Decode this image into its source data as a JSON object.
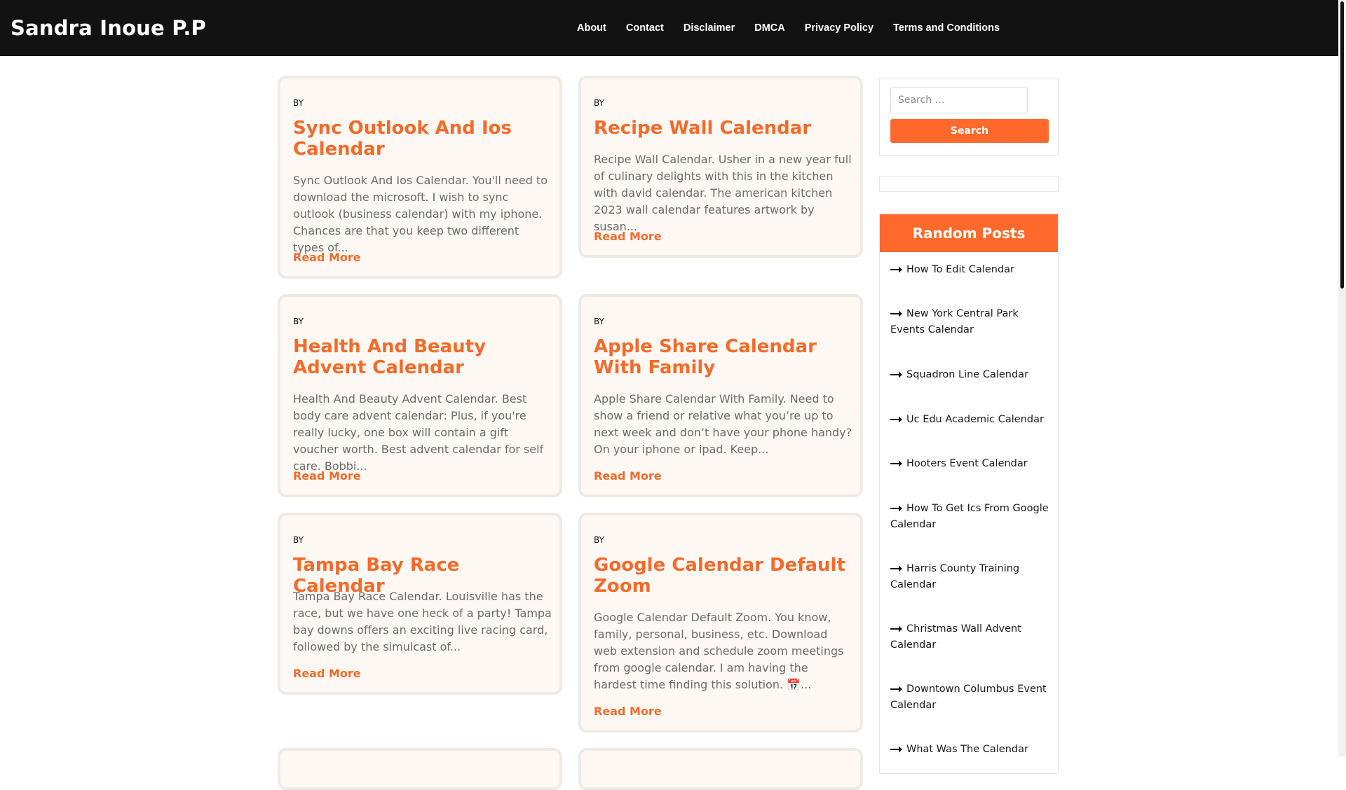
{
  "site": {
    "title": "Sandra Inoue P.P"
  },
  "nav": {
    "items": [
      "About",
      "Contact",
      "Disclaimer",
      "DMCA",
      "Privacy Policy",
      "Terms and Conditions"
    ]
  },
  "posts": [
    {
      "by": "BY",
      "title": "Sync Outlook And Ios Calendar",
      "excerpt": "Sync Outlook And Ios Calendar. You'll need to download the microsoft. I wish to sync outlook (business calendar) with my iphone. Chances are that you keep two different types of...",
      "read_more": "Read More"
    },
    {
      "by": "BY",
      "title": "Recipe Wall Calendar",
      "excerpt": "Recipe Wall Calendar. Usher in a new year full of culinary delights with this in the kitchen with david calendar. The american kitchen 2023 wall calendar features artwork by susan...",
      "read_more": "Read More"
    },
    {
      "by": "BY",
      "title": "Health And Beauty Advent Calendar",
      "excerpt": "Health And Beauty Advent Calendar. Best body care advent calendar: Plus, if you're really lucky, one box will contain a gift voucher worth. Best advent calendar for self care. Bobbi...",
      "read_more": "Read More"
    },
    {
      "by": "BY",
      "title": "Apple Share Calendar With Family",
      "excerpt": "Apple Share Calendar With Family. Need to show a friend or relative what you’re up to next week and don’t have your phone handy? On your iphone or ipad. Keep...",
      "read_more": "Read More"
    },
    {
      "by": "BY",
      "title": "Tampa Bay Race Calendar",
      "excerpt": "Tampa Bay Race Calendar. Louisville has the race, but we have one heck of a party! Tampa bay downs offers an exciting live racing card, followed by the simulcast of...",
      "read_more": "Read More"
    },
    {
      "by": "BY",
      "title": "Google Calendar Default Zoom",
      "excerpt": "Google Calendar Default Zoom. You know, family, personal, business, etc. Download web extension and schedule zoom meetings from google calendar. I am having the hardest time finding this solution. 📅...",
      "read_more": "Read More"
    }
  ],
  "search": {
    "placeholder": "Search …",
    "button_label": "Search"
  },
  "random_posts": {
    "heading": "Random Posts",
    "icon": "long-arrow-right-icon",
    "items": [
      "How To Edit Calendar",
      "New York Central Park Events Calendar",
      "Squadron Line Calendar",
      "Uc Edu Academic Calendar",
      "Hooters Event Calendar",
      "How To Get Ics From Google Calendar",
      "Harris County Training Calendar",
      "Christmas Wall Advent Calendar",
      "Downtown Columbus Event Calendar",
      "What Was The Calendar"
    ]
  },
  "colors": {
    "accent": "#ff6a2c",
    "header_bg": "#121212",
    "card_bg": "#fdf8f3"
  }
}
